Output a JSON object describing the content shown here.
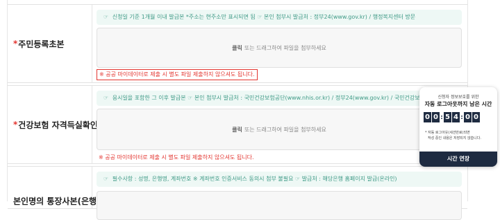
{
  "rows": [
    {
      "required_mark": "*",
      "label": "주민등록초본",
      "notice_icon": "hand-pointing-icon",
      "notice": "신청일 기준 1개월 이내 발급본 *주소는 현주소만 표시되면 됨 ☞ 본인 첨부시 발급처 : 정부24(www.gov.kr) / 행정복지센터 방문",
      "upload_click": "클릭",
      "upload_rest": "또는 드래그하여 파일을 첨부하세요",
      "warning": "※ 공공 마이데이터로 제출 시 별도 파일 제출하지 않으셔도 됩니다."
    },
    {
      "required_mark": "*",
      "label": "건강보험 자격득실확인서",
      "notice_icon": "hand-pointing-icon",
      "notice": "응시일을 포함한 그 이후 발급본 ☞ 본인 첨부시 발급처 : 국민건강보험공단(www.nhis.or.kr) / 정부24(www.gov.kr) / 국민건강보험 고객센터(1577-1000)",
      "upload_click": "클릭",
      "upload_rest": "또는 드래그하여 파일을 첨부하세요",
      "warning": "※ 공공 마이데이터로 제출 시 별도 파일 제출하지 않으셔도 됩니다."
    },
    {
      "label": "본인명의 통장사본(은행",
      "notice_icon": "hand-pointing-icon",
      "notice": "필수사항 : 성명, 은행명, 계좌번호 ※ 계좌번호 인증서비스 동의시 첨부 불필요 ☞ 발급처 : 해당은행 홈페이지 발급(온라인)"
    }
  ],
  "session_popup": {
    "subtitle": "신청자 정보보호를 위한",
    "title": "자동 로그아웃까지 남은 시간",
    "digits": [
      "0",
      "0",
      "5",
      "4",
      "0",
      "0"
    ],
    "separator": ":",
    "note_line1": "* 자동 로그아웃(세션만료)되면",
    "note_line2": "작성 중인 내용은 저장되지 않습니다.",
    "extend_button": "시간 연장",
    "theme_color": "#1e2b41"
  }
}
